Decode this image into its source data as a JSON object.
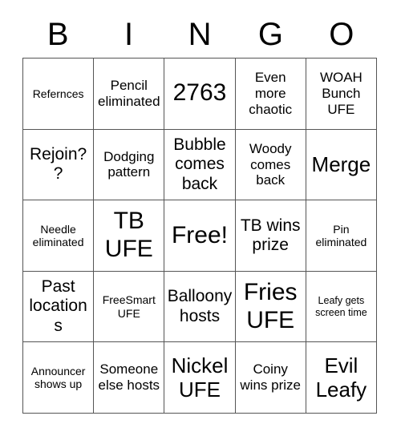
{
  "card": {
    "header": {
      "letters": [
        "B",
        "I",
        "N",
        "G",
        "O"
      ]
    },
    "rows": [
      [
        {
          "text": "Refernces",
          "size": "fs-sm"
        },
        {
          "text": "Pencil eliminated",
          "size": "fs-md"
        },
        {
          "text": "2763",
          "size": "fs-xxl"
        },
        {
          "text": "Even more chaotic",
          "size": "fs-md"
        },
        {
          "text": "WOAH Bunch UFE",
          "size": "fs-md"
        }
      ],
      [
        {
          "text": "Rejoin??",
          "size": "fs-lg"
        },
        {
          "text": "Dodging pattern",
          "size": "fs-md"
        },
        {
          "text": "Bubble comes back",
          "size": "fs-lg"
        },
        {
          "text": "Woody comes back",
          "size": "fs-md"
        },
        {
          "text": "Merge",
          "size": "fs-xl"
        }
      ],
      [
        {
          "text": "Needle eliminated",
          "size": "fs-sm"
        },
        {
          "text": "TB UFE",
          "size": "fs-xxl"
        },
        {
          "text": "Free!",
          "size": "fs-xxl"
        },
        {
          "text": "TB wins prize",
          "size": "fs-lg"
        },
        {
          "text": "Pin eliminated",
          "size": "fs-sm"
        }
      ],
      [
        {
          "text": "Past locations",
          "size": "fs-lg"
        },
        {
          "text": "FreeSmart UFE",
          "size": "fs-sm"
        },
        {
          "text": "Balloony hosts",
          "size": "fs-lg"
        },
        {
          "text": "Fries UFE",
          "size": "fs-xxl"
        },
        {
          "text": "Leafy gets screen time",
          "size": "fs-xs"
        }
      ],
      [
        {
          "text": "Announcer shows up",
          "size": "fs-sm"
        },
        {
          "text": "Someone else hosts",
          "size": "fs-md"
        },
        {
          "text": "Nickel UFE",
          "size": "fs-xl"
        },
        {
          "text": "Coiny wins prize",
          "size": "fs-md"
        },
        {
          "text": "Evil Leafy",
          "size": "fs-xl"
        }
      ]
    ],
    "free_space": {
      "row": 2,
      "col": 2,
      "label": "Free!"
    },
    "colors": {
      "background": "#ffffff",
      "text": "#000000",
      "grid_line": "#555555"
    }
  }
}
